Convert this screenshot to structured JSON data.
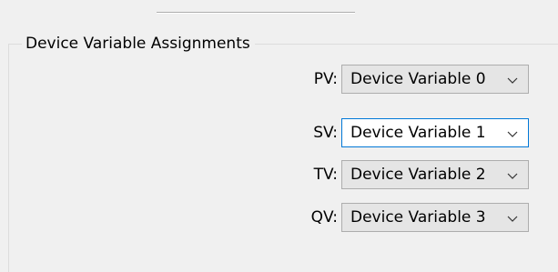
{
  "group": {
    "title": "Device Variable Assignments"
  },
  "assignments": [
    {
      "label": "PV:",
      "value": "Device Variable 0"
    },
    {
      "label": "SV:",
      "value": "Device Variable 1"
    },
    {
      "label": "TV:",
      "value": "Device Variable 2"
    },
    {
      "label": "QV:",
      "value": "Device Variable 3"
    }
  ],
  "icons": {
    "dropdown": "chevron-down-icon"
  },
  "colors": {
    "window_bg": "#f0f0f0",
    "combo_bg": "#e5e5e5",
    "focused_border": "#0078d7"
  }
}
